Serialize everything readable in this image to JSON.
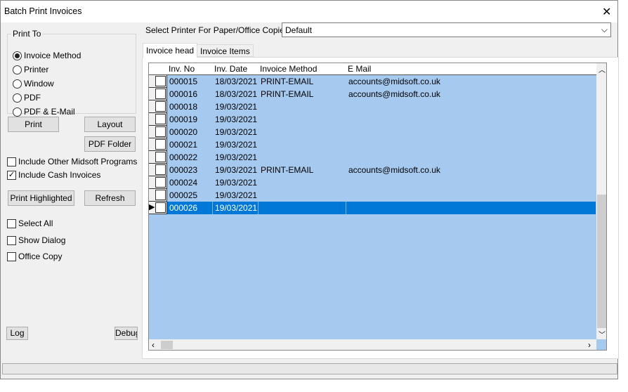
{
  "window": {
    "title": "Batch Print Invoices",
    "close": "✕"
  },
  "print_to": {
    "legend": "Print To",
    "options": [
      "Invoice Method",
      "Printer",
      "Window",
      "PDF",
      "PDF & E-Mail"
    ],
    "selected": 0
  },
  "buttons": {
    "print": "Print",
    "layout": "Layout",
    "pdf_folder": "PDF Folder",
    "print_highlighted": "Print Highlighted",
    "refresh": "Refresh",
    "log": "Log",
    "debug": "Debug"
  },
  "checks": {
    "include_other": "Include Other Midsoft Programs",
    "include_cash": "Include Cash Invoices",
    "select_all": "Select All",
    "show_dialog": "Show Dialog",
    "office_copy": "Office Copy"
  },
  "printer": {
    "label": "Select Printer For Paper/Office Copies",
    "value": "Default"
  },
  "tabs": [
    "Invoice head",
    "Invoice Items"
  ],
  "grid": {
    "columns": [
      "Inv. No",
      "Inv. Date",
      "Invoice Method",
      "E Mail"
    ],
    "rows": [
      [
        "000015",
        "18/03/2021",
        "PRINT-EMAIL",
        "accounts@midsoft.co.uk"
      ],
      [
        "000016",
        "18/03/2021",
        "PRINT-EMAIL",
        "accounts@midsoft.co.uk"
      ],
      [
        "000018",
        "19/03/2021",
        "",
        ""
      ],
      [
        "000019",
        "19/03/2021",
        "",
        ""
      ],
      [
        "000020",
        "19/03/2021",
        "",
        ""
      ],
      [
        "000021",
        "19/03/2021",
        "",
        ""
      ],
      [
        "000022",
        "19/03/2021",
        "",
        ""
      ],
      [
        "000023",
        "19/03/2021",
        "PRINT-EMAIL",
        "accounts@midsoft.co.uk"
      ],
      [
        "000024",
        "19/03/2021",
        "",
        ""
      ],
      [
        "000025",
        "19/03/2021",
        "",
        ""
      ],
      [
        "000026",
        "19/03/2021",
        "",
        ""
      ]
    ],
    "selected_row": 10
  }
}
